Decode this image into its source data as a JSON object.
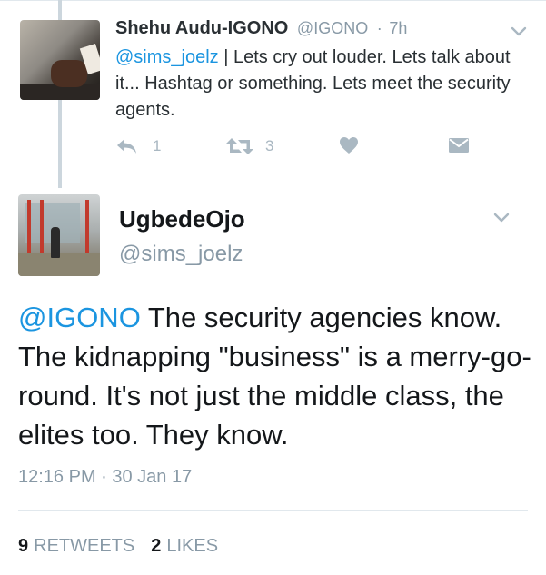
{
  "parent_tweet": {
    "author_name": "Shehu Audu-IGONO",
    "author_handle": "@IGONO",
    "separator": "·",
    "time_ago": "7h",
    "reply_to": "@sims_joelz",
    "body": " | Lets cry out louder. Lets talk about it... Hashtag or something. Lets meet the security agents.",
    "reply_count": "1",
    "retweet_count": "3"
  },
  "main_tweet": {
    "author_name": "UgbedeOjo",
    "author_handle": "@sims_joelz",
    "mention": "@IGONO",
    "body": " The security agencies know. The kidnapping \"business\" is a merry-go-round. It's not just the middle class, the elites too. They know.",
    "timestamp": "12:16 PM · 30 Jan 17",
    "retweets_count": "9",
    "retweets_label": "RETWEETS",
    "likes_count": "2",
    "likes_label": "LIKES"
  },
  "colors": {
    "link": "#1b95e0",
    "muted": "#8899a6",
    "icon": "#aab8c2"
  },
  "icons": [
    "reply-icon",
    "retweet-icon",
    "like-icon",
    "direct-message-icon",
    "chevron-down-icon"
  ]
}
